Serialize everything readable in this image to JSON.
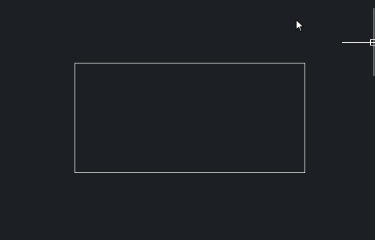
{
  "canvas": {
    "background_color": "#1c1f23",
    "stroke_color": "#ffffff"
  },
  "drawing": {
    "shapes": [
      {
        "kind": "rectangle",
        "name": "rectangle-shape"
      }
    ]
  },
  "crosshair": {
    "icon": "crosshair-cursor-icon"
  },
  "pointer": {
    "icon": "arrow-pointer-icon"
  }
}
